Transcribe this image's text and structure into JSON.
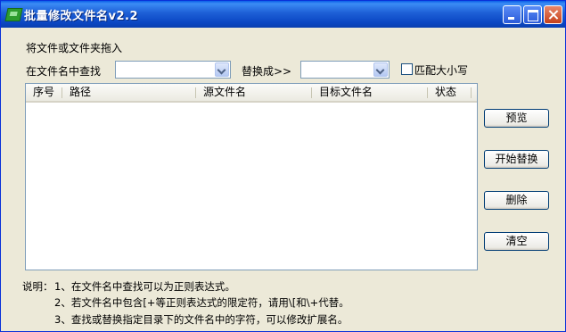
{
  "window": {
    "title": "批量修改文件名v2.2"
  },
  "drop_hint": "将文件或文件夹拖入",
  "find": {
    "label": "在文件名中查找",
    "value": ""
  },
  "replace": {
    "label": "替换成>>",
    "value": ""
  },
  "match_case": {
    "label": "匹配大小写",
    "checked": false
  },
  "list": {
    "columns": [
      "序号",
      "路径",
      "源文件名",
      "目标文件名",
      "状态"
    ],
    "rows": []
  },
  "buttons": {
    "preview": "预览",
    "start_replace": "开始替换",
    "delete": "删除",
    "clear": "清空"
  },
  "notes": {
    "title": "说明：",
    "items": [
      "1、在文件名中查找可以为正则表达式。",
      "2、若文件名中包含[+等正则表达式的限定符，请用\\[和\\+代替。",
      "3、查找或替换指定目录下的文件名中的字符，可以修改扩展名。"
    ]
  },
  "icons": [
    "app-icon",
    "minimize-icon",
    "maximize-icon",
    "close-icon",
    "dropdown-arrow-icon"
  ]
}
